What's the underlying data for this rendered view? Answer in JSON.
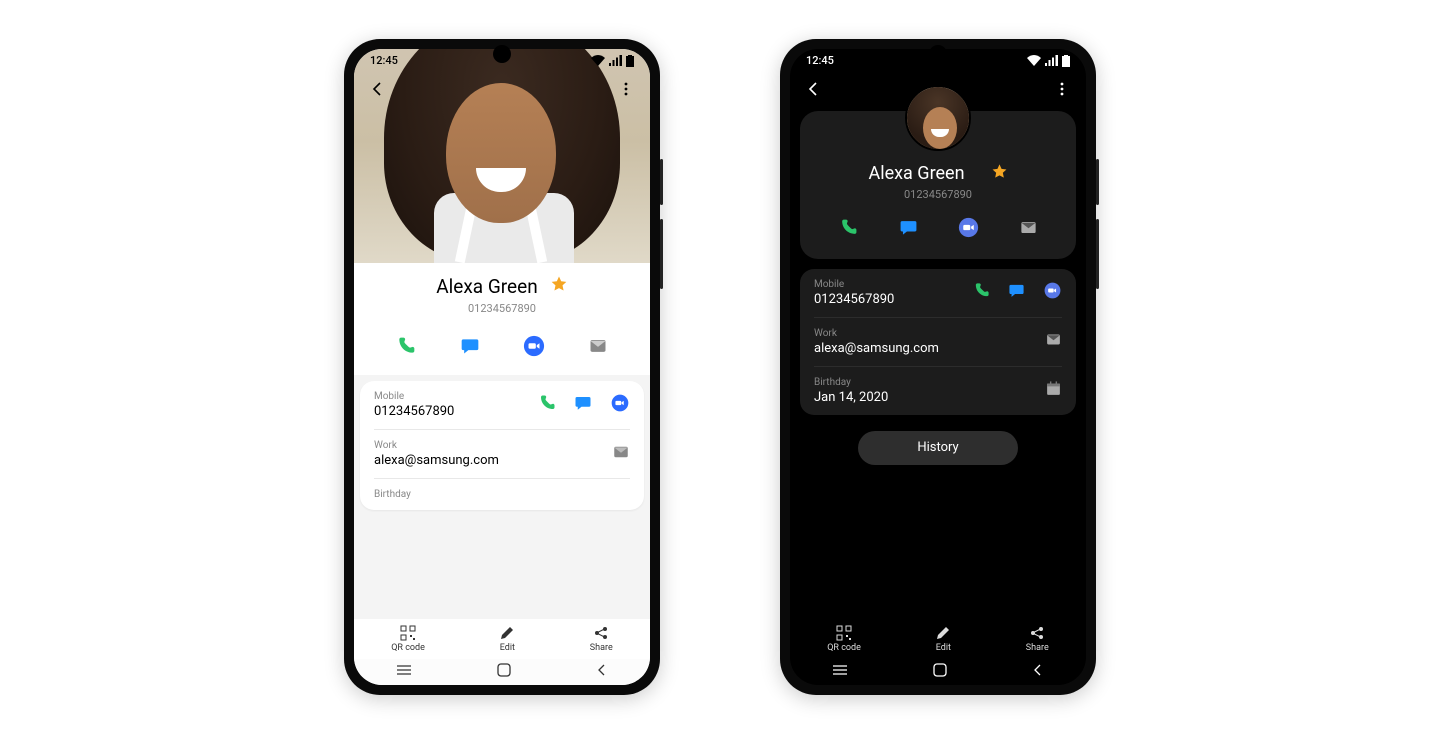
{
  "status": {
    "time": "12:45"
  },
  "contact": {
    "name": "Alexa Green",
    "number": "01234567890",
    "mobile_label": "Mobile",
    "mobile_value": "01234567890",
    "work_label": "Work",
    "work_value": "alexa@samsung.com",
    "birthday_label": "Birthday",
    "birthday_value": "Jan 14, 2020"
  },
  "actions": {
    "history": "History",
    "qr": "QR code",
    "edit": "Edit",
    "share": "Share"
  },
  "colors": {
    "call": "#2bc46a",
    "msg": "#1e90ff",
    "video": "#2b6bff",
    "mail": "#888888",
    "star": "#f5a623"
  }
}
